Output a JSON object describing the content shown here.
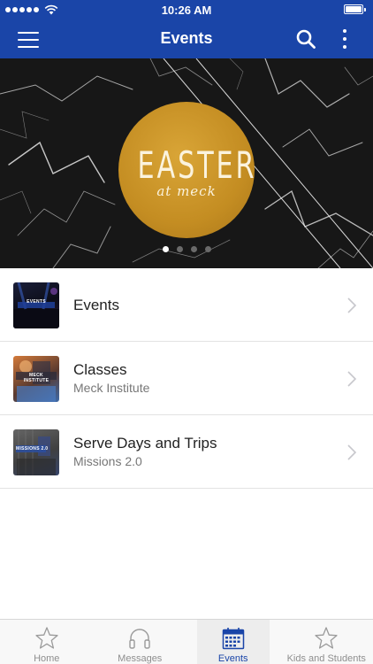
{
  "status_bar": {
    "time": "10:26 AM",
    "signal_icon": "signal-dots-icon",
    "wifi_icon": "wifi-icon",
    "battery_icon": "battery-icon"
  },
  "header": {
    "title": "Events",
    "menu_icon": "hamburger-menu-icon",
    "search_icon": "search-icon",
    "more_icon": "more-vertical-icon",
    "background_color": "#1a45a8"
  },
  "hero": {
    "title": "EASTER",
    "subtitle": "at meck",
    "circle_color": "#c48d22",
    "slides_count": 4,
    "active_slide": 0
  },
  "list": {
    "items": [
      {
        "title": "Events",
        "subtitle": "",
        "thumbnail_text": "EVENTS"
      },
      {
        "title": "Classes",
        "subtitle": "Meck Institute",
        "thumbnail_text": "MECK INSTITUTE"
      },
      {
        "title": "Serve Days and Trips",
        "subtitle": "Missions 2.0",
        "thumbnail_text": "MISSIONS 2.0"
      }
    ],
    "chevron_icon": "chevron-right-icon"
  },
  "tab_bar": {
    "tabs": [
      {
        "label": "Home",
        "icon": "star-icon"
      },
      {
        "label": "Messages",
        "icon": "headphones-icon"
      },
      {
        "label": "Events",
        "icon": "calendar-icon"
      },
      {
        "label": "Kids and Students",
        "icon": "star-icon"
      }
    ],
    "active_tab": "Events",
    "active_color": "#1a45a8",
    "inactive_color": "#8e8e8e"
  }
}
